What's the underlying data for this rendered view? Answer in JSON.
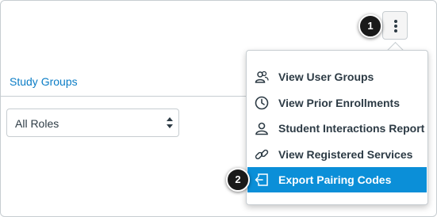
{
  "nav": {
    "study_groups": "Study Groups"
  },
  "filter": {
    "role_selected": "All Roles"
  },
  "callouts": {
    "one": "1",
    "two": "2"
  },
  "menu": {
    "items": [
      {
        "label": "View User Groups",
        "icon": "user-group-icon"
      },
      {
        "label": "View Prior Enrollments",
        "icon": "clock-icon"
      },
      {
        "label": "Student Interactions Report",
        "icon": "user-report-icon"
      },
      {
        "label": "View Registered Services",
        "icon": "link-icon"
      },
      {
        "label": "Export Pairing Codes",
        "icon": "export-icon"
      }
    ]
  },
  "colors": {
    "link": "#0b7dc6",
    "highlight": "#0b8fd8",
    "text": "#2d3b45"
  }
}
